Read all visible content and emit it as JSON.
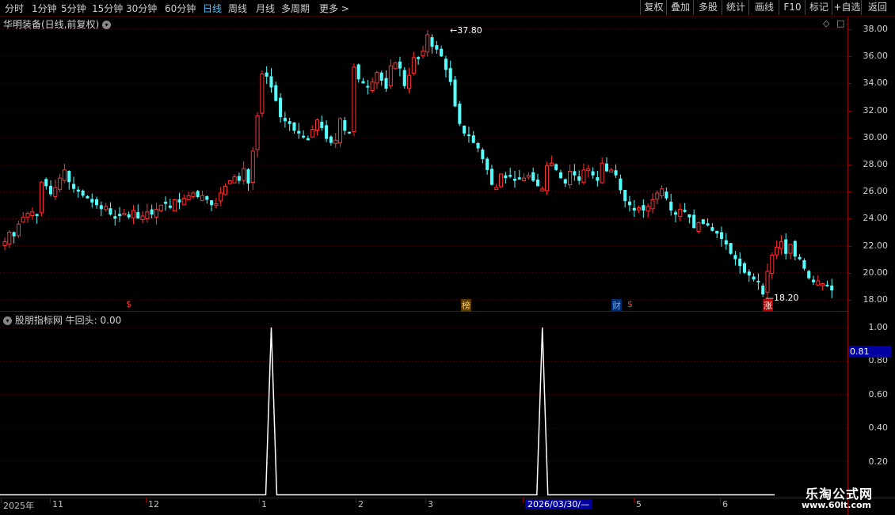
{
  "toolbar": {
    "periods": [
      "分时",
      "1分钟",
      "5分钟",
      "15分钟",
      "30分钟",
      "60分钟",
      "日线",
      "周线",
      "月线",
      "多周期",
      "更多"
    ],
    "active_period": "日线",
    "tools": [
      "复权",
      "叠加",
      "多股",
      "统计",
      "画线",
      "F10",
      "标记",
      "+自选",
      "返回"
    ]
  },
  "main_chart": {
    "title": "华明装备(日线,前复权)",
    "high_label": "37.80",
    "low_label": "18.20",
    "y_ticks": [
      "38.00",
      "36.00",
      "34.00",
      "32.00",
      "30.00",
      "28.00",
      "26.00",
      "24.00",
      "22.00",
      "20.00",
      "18.00"
    ],
    "event_marks": [
      {
        "text": "$",
        "color": "#ff3333"
      },
      {
        "text": "榜",
        "color": "#ffcc66"
      },
      {
        "text": "财",
        "color": "#66aaff"
      },
      {
        "text": "$",
        "color": "#ff3333"
      },
      {
        "text": "涨",
        "color": "#ffffff"
      }
    ]
  },
  "indicator": {
    "title": "股朋指标网 牛回头: 0.00",
    "y_ticks": [
      "1.00",
      "0.80",
      "0.60",
      "0.40",
      "0.20"
    ],
    "cursor_value": "0.81",
    "spikes": [
      {
        "index": 58,
        "value": 1
      },
      {
        "index": 117,
        "value": 1
      }
    ]
  },
  "x_axis": {
    "labels": [
      "2025年",
      "11",
      "12",
      "1",
      "2",
      "3",
      "2026/03/30/—",
      "5",
      "6"
    ]
  },
  "watermark": {
    "name": "乐淘公式网",
    "url": "www.60lt.com"
  },
  "chart_data": {
    "type": "candlestick",
    "up_color": "#ff3232",
    "down_color": "#54ffff",
    "ylim": [
      18,
      38
    ],
    "closes": [
      22.3,
      23.0,
      22.7,
      23.6,
      24.1,
      24.4,
      24.5,
      24.2,
      26.7,
      26.4,
      25.8,
      26.3,
      27.0,
      27.6,
      26.7,
      26.2,
      26.0,
      25.7,
      25.5,
      25.2,
      25.0,
      24.7,
      24.9,
      24.3,
      24.0,
      24.2,
      24.4,
      24.1,
      24.6,
      24.0,
      24.2,
      24.5,
      24.3,
      24.7,
      25.0,
      25.1,
      24.8,
      25.4,
      25.2,
      25.5,
      25.7,
      25.9,
      25.6,
      25.7,
      25.4,
      25.0,
      25.1,
      25.9,
      26.4,
      26.8,
      27.1,
      26.8,
      27.7,
      26.6,
      29.0,
      31.6,
      34.7,
      34.5,
      33.7,
      32.7,
      31.5,
      31.2,
      31.0,
      30.5,
      30.3,
      30.0,
      29.8,
      30.6,
      31.3,
      30.7,
      29.9,
      29.6,
      29.8,
      31.4,
      30.5,
      30.3,
      35.2,
      34.3,
      34.0,
      33.7,
      34.1,
      34.8,
      34.2,
      33.6,
      35.3,
      35.5,
      35.1,
      33.8,
      34.6,
      35.9,
      35.8,
      36.4,
      37.6,
      36.7,
      36.5,
      36.0,
      35.0,
      34.1,
      32.3,
      31.0,
      30.3,
      30.1,
      29.6,
      29.2,
      28.4,
      27.6,
      26.5,
      26.3,
      27.3,
      27.0,
      27.1,
      26.8,
      26.9,
      27.0,
      27.2,
      26.8,
      26.4,
      26.2,
      27.9,
      28.1,
      27.6,
      27.0,
      26.6,
      27.5,
      27.2,
      26.8,
      27.6,
      27.7,
      27.2,
      26.8,
      28.1,
      27.5,
      27.6,
      27.2,
      26.1,
      25.3,
      25.0,
      24.6,
      24.8,
      24.6,
      24.9,
      25.4,
      25.9,
      26.2,
      25.5,
      24.6,
      24.3,
      24.7,
      24.5,
      24.1,
      23.3,
      23.7,
      23.6,
      23.5,
      23.1,
      22.9,
      22.5,
      22.1,
      21.4,
      21.0,
      20.5,
      20.0,
      19.8,
      19.5,
      19.3,
      18.4,
      20.1,
      21.3,
      21.9,
      22.3,
      21.4,
      22.1,
      21.2,
      21.0,
      20.3,
      19.6,
      19.3,
      19.4,
      19.2,
      19.0,
      18.7
    ]
  }
}
